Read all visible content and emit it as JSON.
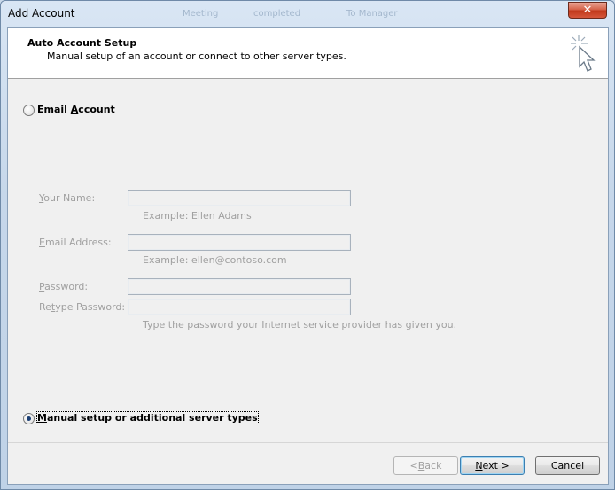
{
  "window": {
    "title": "Add Account",
    "close_glyph": "✕"
  },
  "background_taskbar": [
    "Meeting",
    "completed",
    "To Manager"
  ],
  "header": {
    "title": "Auto Account Setup",
    "subtitle": "Manual setup of an account or connect to other server types.",
    "icon": "cursor-sparkle-icon"
  },
  "email_account": {
    "label_pre": "Email ",
    "label_access": "A",
    "label_post": "ccount",
    "selected": false
  },
  "fields": {
    "name": {
      "label_access": "Y",
      "label_rest": "our Name:",
      "value": "",
      "hint": "Example: Ellen Adams"
    },
    "email": {
      "label_access": "E",
      "label_rest": "mail Address:",
      "value": "",
      "hint": "Example: ellen@contoso.com"
    },
    "password": {
      "label_access": "P",
      "label_rest": "assword:",
      "value": ""
    },
    "retype": {
      "label_pre": "Re",
      "label_access": "t",
      "label_rest": "ype Password:",
      "value": "",
      "hint": "Type the password your Internet service provider has given you."
    }
  },
  "manual_setup": {
    "label_access": "M",
    "label_rest": "anual setup or additional server types",
    "selected": true
  },
  "buttons": {
    "back_pre": "< ",
    "back_access": "B",
    "back_post": "ack",
    "next_access": "N",
    "next_post": "ext >",
    "cancel": "Cancel"
  },
  "colors": {
    "disabled_text": "#a0a0a0",
    "radio_dot": "#1b3f74",
    "close_red": "#c1391b"
  }
}
